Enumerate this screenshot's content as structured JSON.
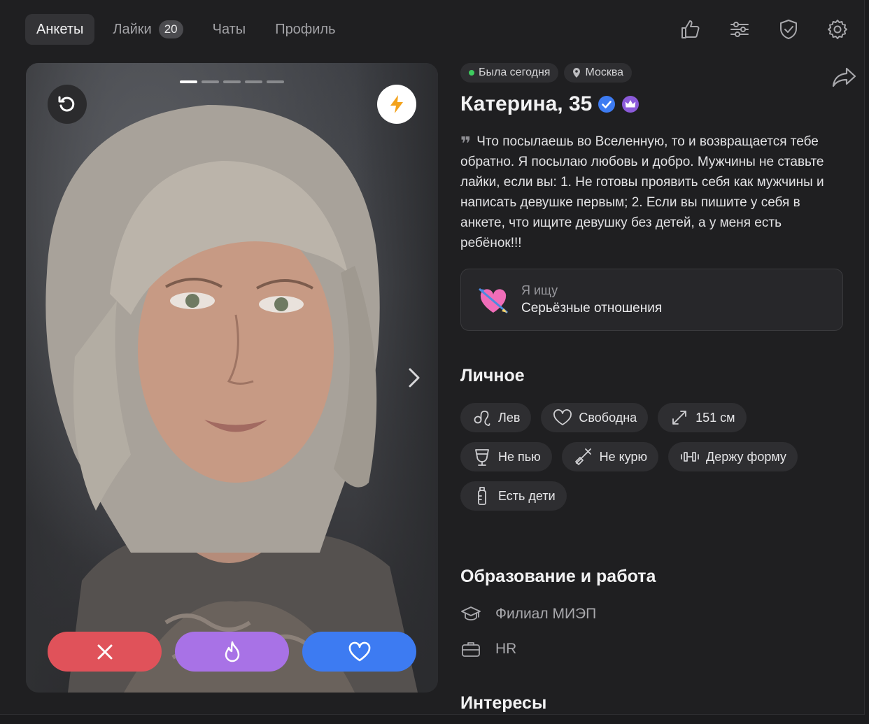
{
  "nav": {
    "tabs": [
      {
        "label": "Анкеты",
        "active": true
      },
      {
        "label": "Лайки",
        "badge": "20"
      },
      {
        "label": "Чаты"
      },
      {
        "label": "Профиль"
      }
    ],
    "icons": [
      "thumbs-up-icon",
      "sliders-icon",
      "shield-check-icon",
      "gear-icon"
    ]
  },
  "photo": {
    "count": 5,
    "current": 1,
    "buttons": {
      "dislike": "close-icon",
      "super": "fire-icon",
      "like": "heart-icon"
    }
  },
  "profile": {
    "status": "Была сегодня",
    "city": "Москва",
    "name": "Катерина, 35",
    "bio": "Что посылаешь во Вселенную, то и возвращается тебе обратно. Я посылаю любовь и добро. Мужчины не ставьте лайки, если вы: 1. Не готовы проявить себя как мужчины и написать девушке первым; 2. Если вы пишите у себя в анкете, что ищите девушку без детей, а у меня есть ребёнок!!!",
    "seeking_label": "Я ищу",
    "seeking_value": "Серьёзные отношения"
  },
  "personal": {
    "title": "Личное",
    "tags": [
      {
        "label": "Лев",
        "icon": "leo-icon"
      },
      {
        "label": "Свободна",
        "icon": "heart-outline-icon"
      },
      {
        "label": "151 см",
        "icon": "height-icon"
      },
      {
        "label": "Не пью",
        "icon": "glass-icon"
      },
      {
        "label": "Не курю",
        "icon": "no-smoking-icon"
      },
      {
        "label": "Держу форму",
        "icon": "dumbbell-icon"
      },
      {
        "label": "Есть дети",
        "icon": "baby-bottle-icon"
      }
    ]
  },
  "education": {
    "title": "Образование и работа",
    "school": "Филиал МИЭП",
    "job": "HR"
  },
  "interests": {
    "title": "Интересы"
  },
  "colors": {
    "dislike": "#e0525a",
    "super": "#a872e6",
    "like": "#3d7bf2",
    "online": "#3ecc5f"
  }
}
